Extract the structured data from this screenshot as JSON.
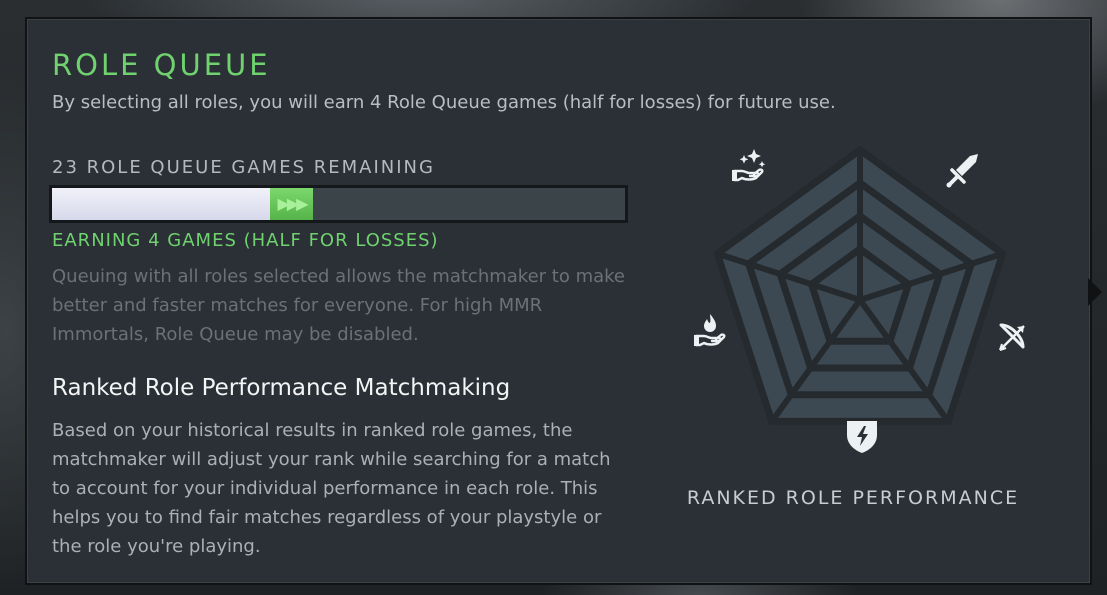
{
  "role_queue": {
    "title": "ROLE QUEUE",
    "subtitle": "By selecting all roles, you will earn 4 Role Queue games (half for losses) for future use.",
    "games_remaining_label": "23 ROLE QUEUE GAMES REMAINING",
    "progress": {
      "current_fraction": 0.38,
      "earning_fraction": 0.075,
      "earn_arrows": "▶▶▶"
    },
    "earning_label": "EARNING 4 GAMES (HALF FOR LOSSES)",
    "info_text": "Queuing with all roles selected allows the matchmaker to make better and faster matches for everyone. For high MMR Immortals, Role Queue may be disabled."
  },
  "ranked_performance": {
    "title": "Ranked Role Performance Matchmaking",
    "body": "Based on your historical results in ranked role games, the matchmaker will adjust your rank while searching for a match to account for your individual performance in each role. This helps you to find fair matches regardless of your playstyle or the role you're playing.",
    "chart_label": "RANKED ROLE PERFORMANCE",
    "roles": [
      {
        "icon": "sparkle-hand-icon"
      },
      {
        "icon": "sword-icon"
      },
      {
        "icon": "bow-icon"
      },
      {
        "icon": "shield-bolt-icon"
      },
      {
        "icon": "flame-hand-icon"
      }
    ]
  },
  "colors": {
    "accent_green": "#6fd26f",
    "panel_bg": "#2a3035",
    "radar_fill": "#3f4b55"
  }
}
